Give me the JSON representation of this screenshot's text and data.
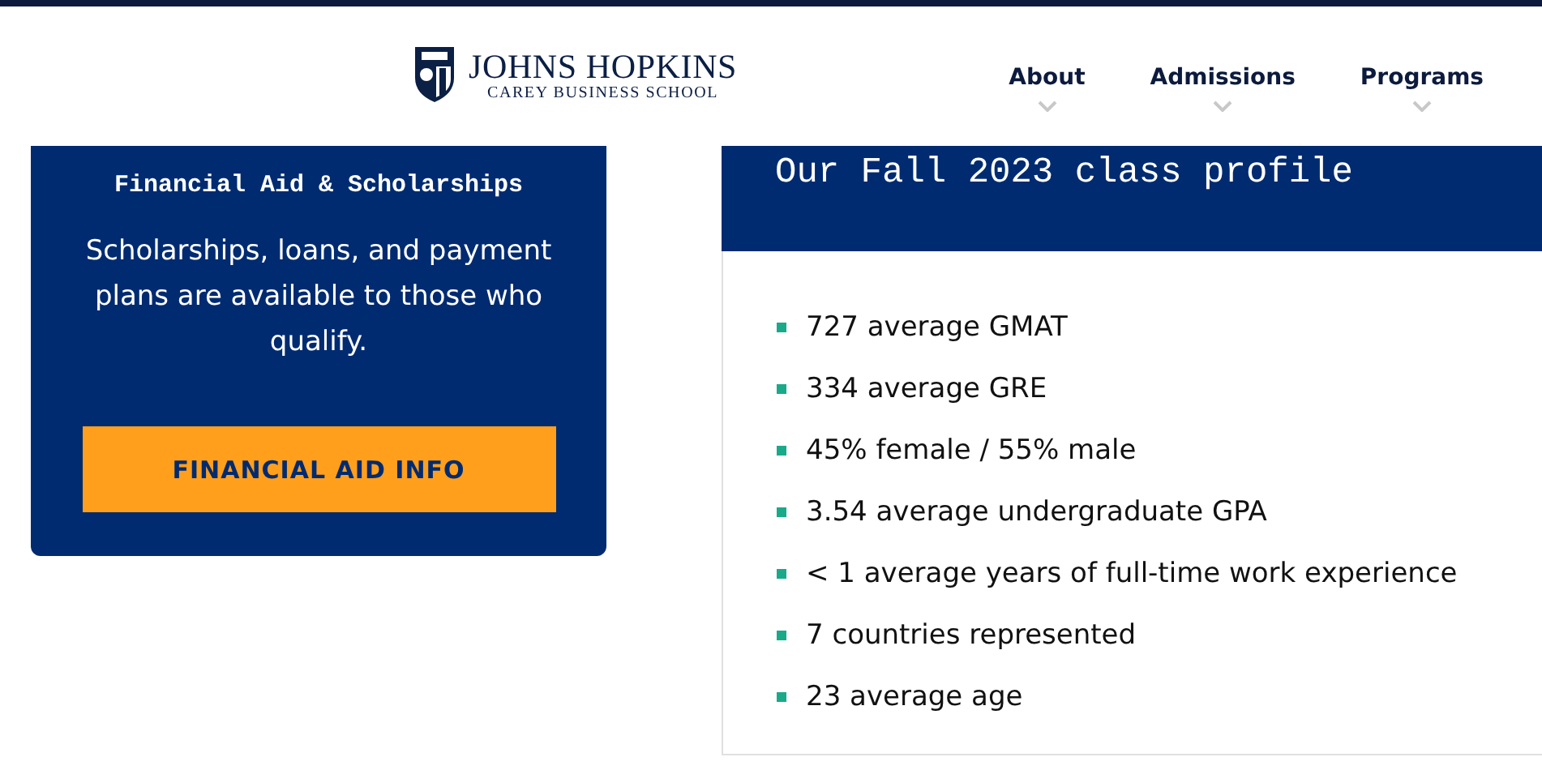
{
  "header": {
    "logo": {
      "title": "JOHNS HOPKINS",
      "subtitle": "CAREY BUSINESS SCHOOL"
    },
    "nav": [
      {
        "label": "About"
      },
      {
        "label": "Admissions"
      },
      {
        "label": "Programs"
      }
    ]
  },
  "aid_card": {
    "title": "Financial Aid & Scholarships",
    "text": "Scholarships, loans, and payment plans are available to those who qualify.",
    "button": "FINANCIAL AID INFO"
  },
  "profile": {
    "title": "Our Fall 2023 class profile",
    "items": [
      "727 average GMAT",
      "334 average GRE",
      "45% female / 55% male",
      "3.54 average undergraduate GPA",
      "< 1 average years of full-time work experience",
      "7 countries represented",
      "23 average age"
    ]
  }
}
